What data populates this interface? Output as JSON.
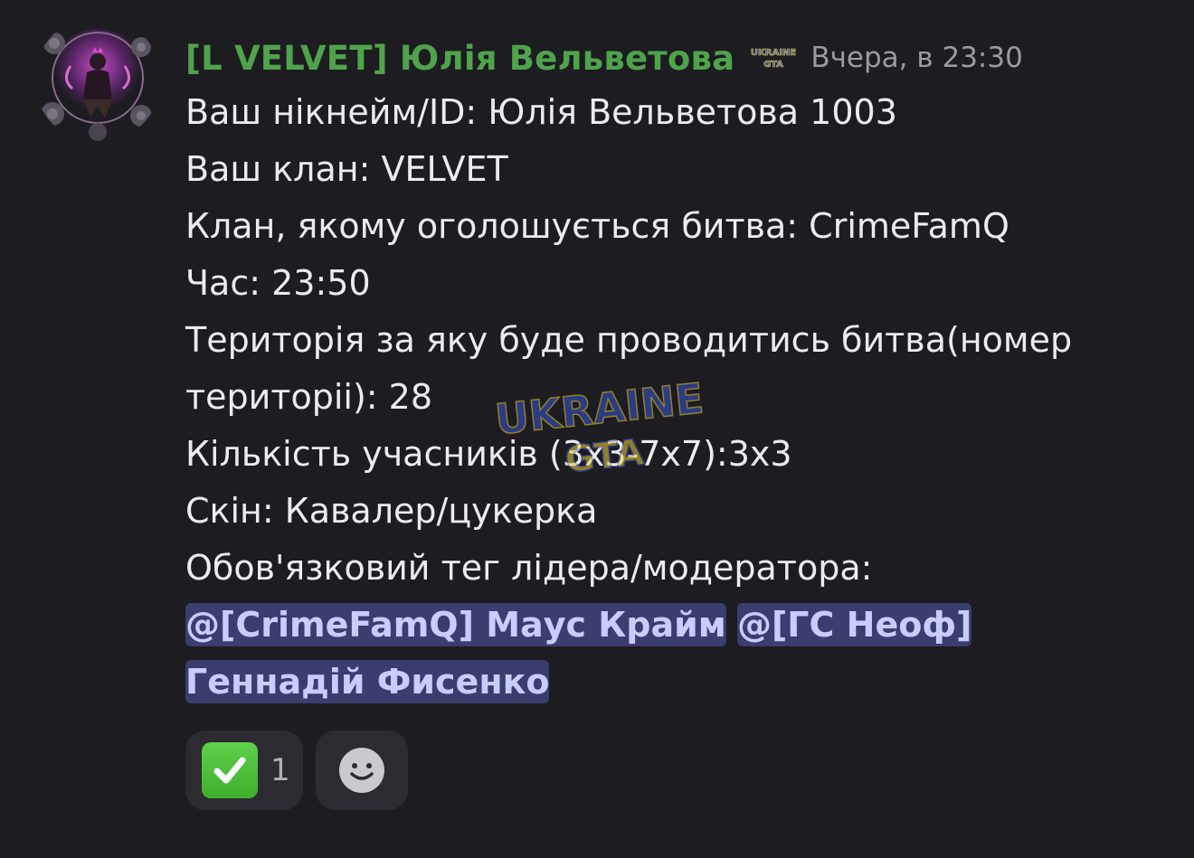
{
  "message": {
    "author": "[L VELVET] Юлія Вельветова",
    "timestamp": "Вчера, в 23:30",
    "author_color": "#4fa34a",
    "lines": [
      "Ваш нікнейм/ID: Юлія Вельветова  1003",
      "Ваш клан: VELVET",
      "Клан, якому оголошується битва: CrimeFamQ",
      "Час:  23:50",
      "Територія за яку буде проводитись битва(номер територіі): 28",
      "Кількість учасників (3x3-7x7):3x3",
      "Скін: Кавалер/цукерка",
      "Обов'язковий тег лідера/модератора:"
    ],
    "mentions": [
      "@[CrimeFamQ] Маус Крайм",
      "@[ГС Неоф] Геннадій Фисенко"
    ],
    "mention_color": "#c8ccff",
    "mention_bg": "#3a3d6e"
  },
  "icons": {
    "avatar": "avatar-image",
    "role": "ukraine-gta-role-icon",
    "watermark": "ukraine-gta-watermark"
  },
  "reactions": [
    {
      "emoji": "check-mark-emoji",
      "count": "1"
    },
    {
      "emoji": "add-reaction-smile-icon"
    }
  ]
}
